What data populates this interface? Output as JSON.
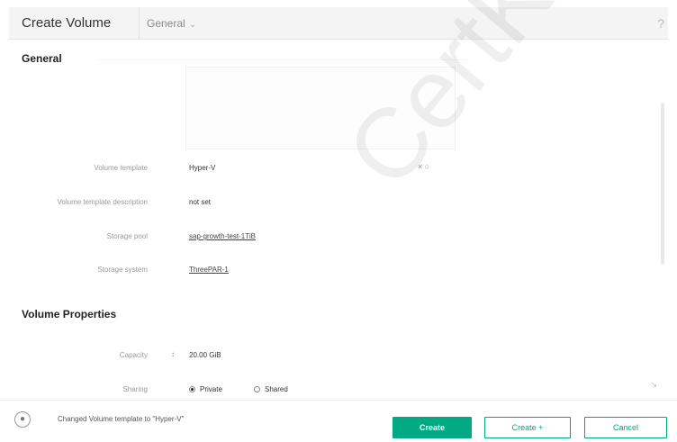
{
  "header": {
    "title": "Create Volume",
    "section_dropdown": "General",
    "help": "?"
  },
  "general": {
    "section_title": "General",
    "fields": [
      {
        "label": "Volume template",
        "value": "Hyper-V"
      },
      {
        "label": "Volume template description",
        "value": "not set"
      },
      {
        "label": "Storage pool",
        "value": "sap-growth-test-1TiB"
      },
      {
        "label": "Storage system",
        "value": "ThreePAR-1"
      }
    ]
  },
  "volume_properties": {
    "section_title": "Volume Properties",
    "capacity_label": "Capacity",
    "capacity_value": "20.00 GiB",
    "sharing_label": "Sharing",
    "sharing_options": [
      "Private",
      "Shared"
    ],
    "sharing_selected": "Private"
  },
  "footer": {
    "status_message": "Changed Volume template to \"Hyper-V\"",
    "create_label": "Create",
    "create_plus_label": "Create +",
    "cancel_label": "Cancel"
  },
  "watermark": "CertKillers",
  "colors": {
    "accent": "#01a982",
    "header_bg": "#f4f4f4"
  },
  "icons": {
    "help": "help-icon",
    "clear": "clear-icon",
    "status": "notification-icon"
  }
}
